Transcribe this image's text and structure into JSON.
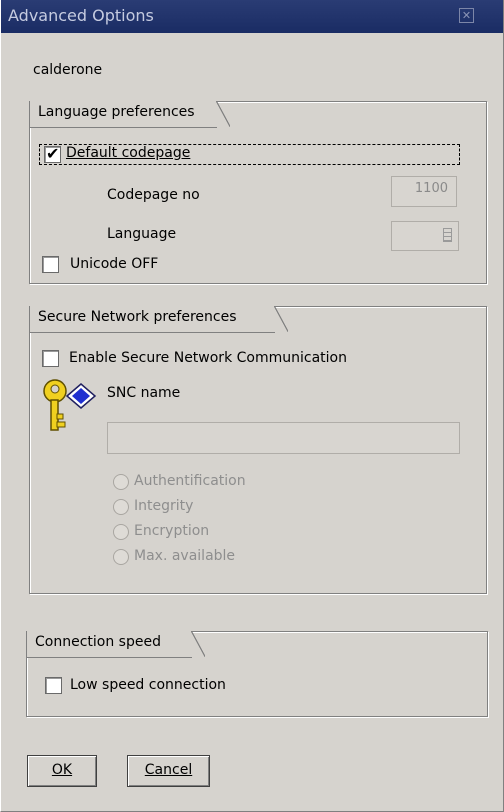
{
  "window": {
    "title": "Advanced Options"
  },
  "user": "calderone",
  "language_group": {
    "title": "Language preferences",
    "default_codepage_label": "Default codepage",
    "default_codepage_checked": true,
    "codepage_no_label": "Codepage no",
    "codepage_value": "1100",
    "language_label": "Language",
    "unicode_off_label": "Unicode OFF",
    "unicode_off_checked": false
  },
  "snc_group": {
    "title": "Secure Network preferences",
    "enable_label": "Enable Secure Network Communication",
    "enable_checked": false,
    "snc_name_label": "SNC name",
    "radios": [
      "Authentification",
      "Integrity",
      "Encryption",
      "Max. available"
    ]
  },
  "speed_group": {
    "title": "Connection speed",
    "low_speed_label": "Low speed connection",
    "low_speed_checked": false
  },
  "buttons": {
    "ok": "OK",
    "cancel": "Cancel"
  },
  "icons": {
    "close": "close-icon",
    "snc": "key-certificate-icon",
    "combo": "dropdown-icon"
  },
  "colors": {
    "titlebar": "#1f3169",
    "face": "#d6d3ce",
    "disabled_text": "#8e8e8e"
  }
}
